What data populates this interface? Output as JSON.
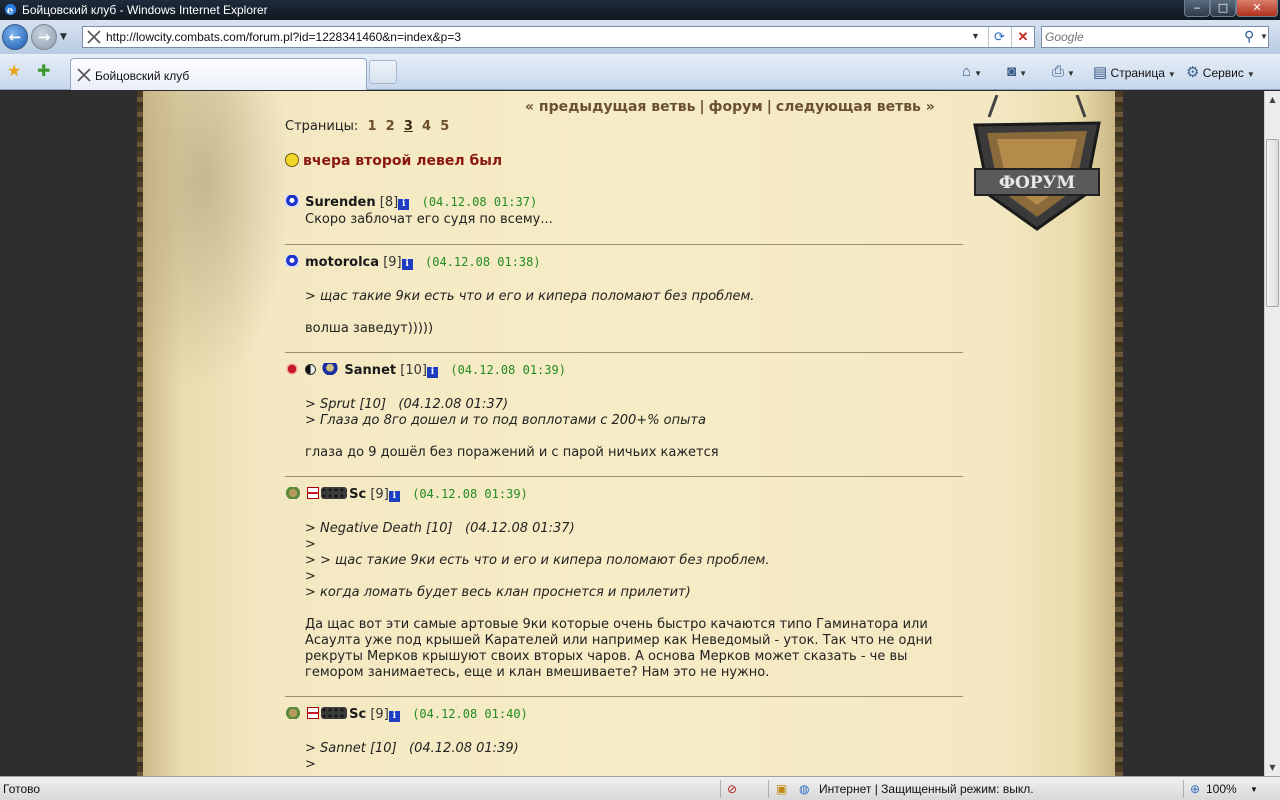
{
  "window": {
    "title": "Бойцовский клуб - Windows Internet Explorer",
    "controls": {
      "minimize": "‒",
      "maximize": "□",
      "close": "✕"
    }
  },
  "address_bar": {
    "url": "http://lowcity.combats.com/forum.pl?id=1228341460&n=index&p=3",
    "search_placeholder": "Google"
  },
  "tab": {
    "label": "Бойцовский клуб"
  },
  "toolbar": {
    "page_label": "Страница",
    "service_label": "Сервис"
  },
  "page": {
    "topnav": {
      "prev": "« предыдущая ветвь",
      "forum": "форум",
      "next": "следующая ветвь »",
      "sep": "|"
    },
    "pages_label": "Страницы:",
    "pages": [
      "1",
      "2",
      "3",
      "4",
      "5"
    ],
    "current_page": "3",
    "topic_title": "вчера второй левел был",
    "logo_text": "ФОРУМ"
  },
  "posts": [
    {
      "nick": "Surenden",
      "level": "[8]",
      "date": "(04.12.08 01:37)",
      "lines": [
        "Скоро заблочат его судя по всему..."
      ]
    },
    {
      "nick": "motorolca",
      "level": "[9]",
      "date": "(04.12.08 01:38)",
      "quote": [
        "> щас такие 9ки есть что и его и кипера поломают без проблем."
      ],
      "lines": [
        "волша заведут)))))"
      ]
    },
    {
      "nick": "Sannet",
      "level": "[10]",
      "date": "(04.12.08 01:39)",
      "quote": [
        "> Sprut [10]   (04.12.08 01:37)",
        "> Глаза до 8го дошел и то под воплотами с 200+% опыта"
      ],
      "lines": [
        "глаза до 9 дошёл без поражений и с парой ничьих кажется"
      ]
    },
    {
      "nick": "Sc",
      "level": "[9]",
      "date": "(04.12.08 01:39)",
      "quote": [
        "> Negative Death [10]   (04.12.08 01:37)",
        ">",
        "> > щас такие 9ки есть что и его и кипера поломают без проблем.",
        ">",
        "> когда ломать будет весь клан проснется и прилетит)"
      ],
      "lines": [
        "Да щас вот эти самые артовые 9ки которые очень быстро качаются типо Гаминатора или",
        "Асаулта уже под крышей Карателей или например как Неведомый - уток. Так что не одни",
        "рекруты Мерков крышуют своих вторых чаров. А основа Мерков может сказать - че вы",
        "гемором занимаетесь, еще и клан вмешиваете? Нам это не нужно."
      ]
    },
    {
      "nick": "Sc",
      "level": "[9]",
      "date": "(04.12.08 01:40)",
      "quote": [
        "> Sannet [10]   (04.12.08 01:39)",
        ">"
      ]
    }
  ],
  "status": {
    "left": "Готово",
    "zone": "Интернет | Защищенный режим: выкл.",
    "zoom": "100%"
  },
  "colors": {
    "topic": "#8b1810",
    "date": "#228b22",
    "nav": "#6b5030"
  }
}
